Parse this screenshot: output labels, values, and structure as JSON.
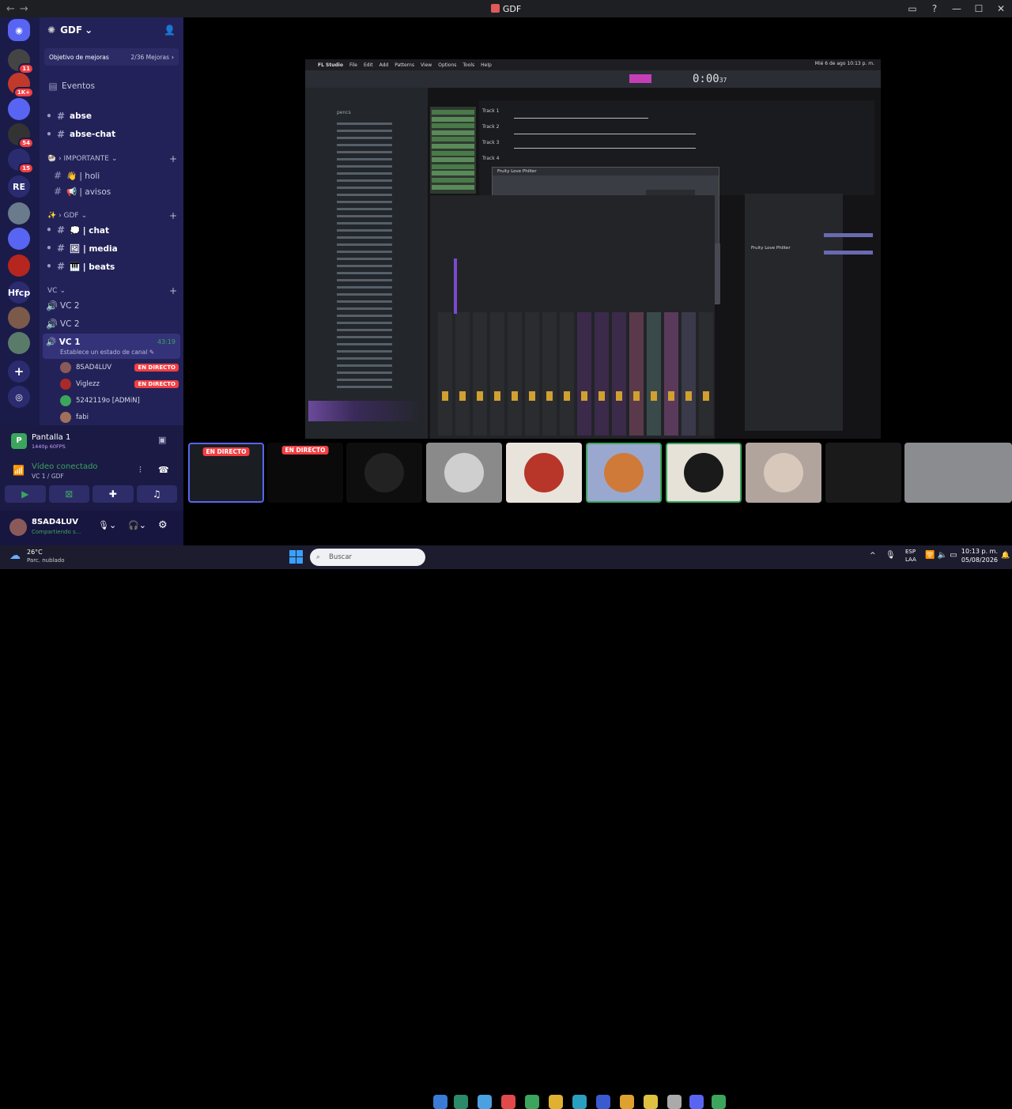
{
  "window": {
    "title": "GDF"
  },
  "server": {
    "name": "GDF"
  },
  "goal": {
    "label": "Objetivo de mejoras",
    "progress": "2/36 Mejoras"
  },
  "channels": {
    "events": "Eventos",
    "abse": "abse",
    "abse_chat": "abse-chat",
    "cat_importante": "IMPORTANTE",
    "holi": "👋 | holi",
    "avisos": "📢 | avisos",
    "cat_gdf": "GDF",
    "chat": "💭 | chat",
    "media": "🖼 | media",
    "beats": "🎹 | beats",
    "cat_vc": "VC",
    "vc2a": "VC 2",
    "vc2b": "VC 2",
    "vc1": "VC 1",
    "vc1_time": "43:19",
    "vc1_status": "Establece un estado de canal"
  },
  "voice_users": [
    {
      "name": "8SAD4LUV",
      "live": "EN DIRECTO"
    },
    {
      "name": "Viglezz",
      "live": "EN DIRECTO"
    },
    {
      "name": "5242119o [ADMiN]",
      "live": ""
    },
    {
      "name": "fabi",
      "live": ""
    }
  ],
  "panel": {
    "screen_title": "Pantalla 1",
    "screen_quality": "1440p 60FPS",
    "video_status": "Vídeo conectado",
    "video_channel": "VC 1 / GDF",
    "user_name": "8SAD4LUV",
    "user_status": "Compartiendo s..."
  },
  "server_icons": [
    {
      "label": "",
      "badge": "11",
      "color": "#444"
    },
    {
      "label": "",
      "badge": "1K+",
      "color": "#c0392b"
    },
    {
      "label": "",
      "badge": "",
      "color": "#5865f2"
    },
    {
      "label": "",
      "badge": "54",
      "color": "#333"
    },
    {
      "label": "",
      "badge": "15",
      "color": "#2b2b70"
    },
    {
      "label": "RE",
      "badge": "",
      "color": "#2b2b70"
    },
    {
      "label": "",
      "badge": "",
      "color": "#6a7b8c"
    },
    {
      "label": "",
      "badge": "",
      "color": "#5865f2"
    },
    {
      "label": "",
      "badge": "",
      "color": "#b5261e"
    },
    {
      "label": "Hfcp",
      "badge": "",
      "color": "#2b2b70"
    },
    {
      "label": "",
      "badge": "",
      "color": "#7b5a4a"
    },
    {
      "label": "",
      "badge": "",
      "color": "#5a7b6a"
    }
  ],
  "fl_studio": {
    "menu": [
      "FL Studio",
      "File",
      "Edit",
      "Add",
      "Patterns",
      "View",
      "Options",
      "Tools",
      "Help"
    ],
    "clock": "Mié 6 de ago 10:13 p. m.",
    "time": "0:00",
    "time_small": "37",
    "plugin_title": "Fruity Love Philter",
    "tracks": [
      "Track 1",
      "Track 2",
      "Track 3",
      "Track 4"
    ],
    "browser_item": "pencs"
  },
  "tiles": [
    {
      "live": "EN DIRECTO"
    },
    {
      "live": "EN DIRECTO"
    },
    {
      "live": ""
    },
    {
      "live": ""
    },
    {
      "live": ""
    },
    {
      "live": ""
    },
    {
      "live": ""
    },
    {
      "live": ""
    },
    {
      "live": ""
    },
    {
      "live": ""
    }
  ],
  "taskbar": {
    "weather_temp": "26°C",
    "weather_desc": "Parc. nublado",
    "search_placeholder": "Buscar",
    "lang": "ESP",
    "lang2": "LAA",
    "time": "10:13 p. m.",
    "date": "05/08/2026"
  },
  "colors": {
    "accent": "#5865f2",
    "live": "#f23f43",
    "sidebar": "#232258"
  }
}
